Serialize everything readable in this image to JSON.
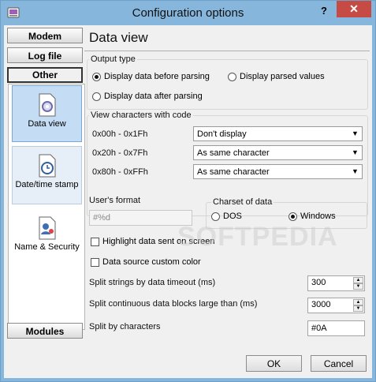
{
  "window": {
    "title": "Configuration options",
    "help_label": "?",
    "close_label": "✕"
  },
  "sidebar": {
    "buttons": {
      "modem": "Modem",
      "logfile": "Log file",
      "other": "Other",
      "modules": "Modules"
    },
    "items": [
      {
        "label": "Data view",
        "icon": "gear-page-icon"
      },
      {
        "label": "Date/time stamp",
        "icon": "clock-page-icon"
      },
      {
        "label": "Name & Security",
        "icon": "user-key-page-icon"
      }
    ]
  },
  "main": {
    "heading": "Data view",
    "output_type": {
      "label": "Output type",
      "options": [
        "Display data before parsing",
        "Display parsed values",
        "Display data after parsing"
      ],
      "selected": "Display data before parsing"
    },
    "view_chars": {
      "label": "View characters with code",
      "rows": [
        {
          "range": "0x00h - 0x1Fh",
          "value": "Don't display"
        },
        {
          "range": "0x20h - 0x7Fh",
          "value": "As same character"
        },
        {
          "range": "0x80h - 0xFFh",
          "value": "As same character"
        }
      ]
    },
    "user_format": {
      "label": "User's format",
      "placeholder": "#%d"
    },
    "charset": {
      "label": "Charset of data",
      "options": [
        "DOS",
        "Windows"
      ],
      "selected": "Windows"
    },
    "checks": {
      "highlight": "Highlight data sent on screen",
      "custom_color": "Data source custom color"
    },
    "split_timeout": {
      "label": "Split strings by data timeout (ms)",
      "value": "300"
    },
    "split_blocks": {
      "label": "Split continuous data blocks large than (ms)",
      "value": "3000"
    },
    "split_chars": {
      "label": "Split by characters",
      "value": "#0A"
    }
  },
  "footer": {
    "ok": "OK",
    "cancel": "Cancel"
  },
  "watermark": "SOFTPEDIA",
  "colors": {
    "titlebar": "#86b6dc",
    "close": "#c74b45",
    "selected_item": "#c4dcf4"
  }
}
